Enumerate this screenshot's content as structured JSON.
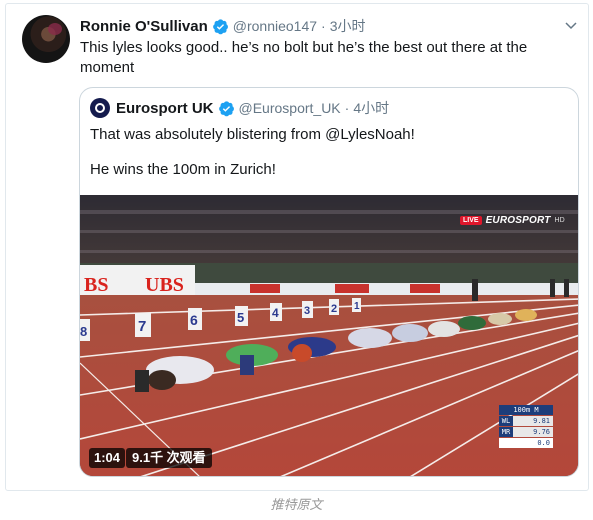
{
  "tweet": {
    "author_name": "Ronnie O'Sullivan",
    "handle": "@ronnieo147",
    "separator": "·",
    "time": "3小时",
    "text": "This lyles looks good.. he’s no bolt but he’s the best out there at the moment"
  },
  "quoted": {
    "author_name": "Eurosport UK",
    "handle": "@Eurosport_UK",
    "separator": "·",
    "time": "4小时",
    "line1": "That was absolutely blistering from @LylesNoah!",
    "line2": "He wins the 100m in Zurich!"
  },
  "video": {
    "duration": "1:04",
    "views": "9.1千 次观看",
    "live_badge": "LIVE",
    "broadcaster": "EUROSPORT",
    "quality": "HD",
    "sponsor": "UBS",
    "lane_numbers": [
      "8",
      "7",
      "6",
      "5",
      "4",
      "3",
      "2",
      "1"
    ],
    "scoreboard": {
      "title": "100m M",
      "rows": [
        {
          "key": "WL",
          "value": "9.81"
        },
        {
          "key": "MR",
          "value": "9.76"
        }
      ],
      "extra": "0.0"
    }
  },
  "caption": "推特原文",
  "colors": {
    "verified": "#1da1f2",
    "track": "#b0483a",
    "text_secondary": "#657786"
  }
}
